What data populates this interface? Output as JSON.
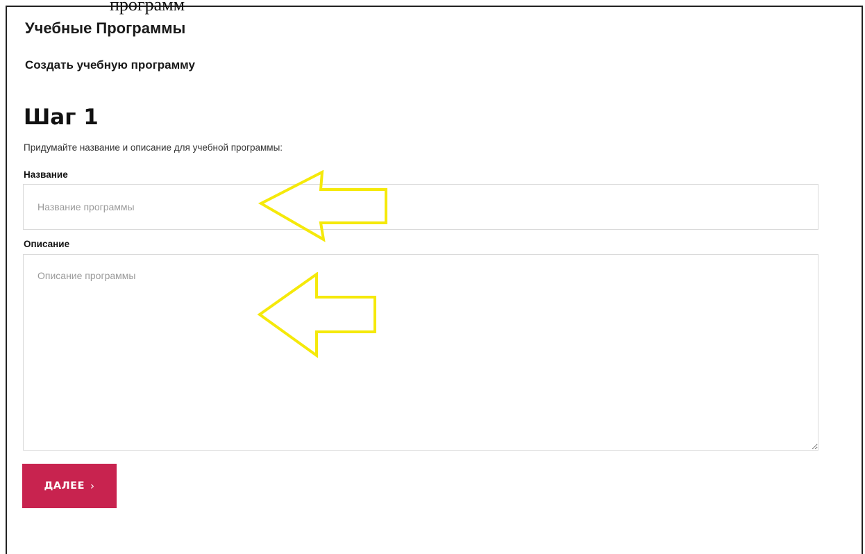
{
  "page": {
    "caption_fragment": "программ",
    "app_title": "Учебные Программы",
    "subtitle": "Создать учебную программу"
  },
  "form": {
    "step_heading": "Шаг 1",
    "instruction": "Придумайте название и описание для учебной программы:",
    "name_label": "Название",
    "name_placeholder": "Название программы",
    "name_value": "",
    "description_label": "Описание",
    "description_placeholder": "Описание программы",
    "description_value": "",
    "next_label": "ДАЛЕЕ",
    "next_icon": "chevron-right-icon"
  },
  "annotations": {
    "arrow_color": "#f5e90a",
    "arrow_icon": "arrow-left-icon"
  },
  "colors": {
    "accent": "#c8234f",
    "input_border": "#d9d9d9",
    "placeholder": "#9a9a9a"
  }
}
